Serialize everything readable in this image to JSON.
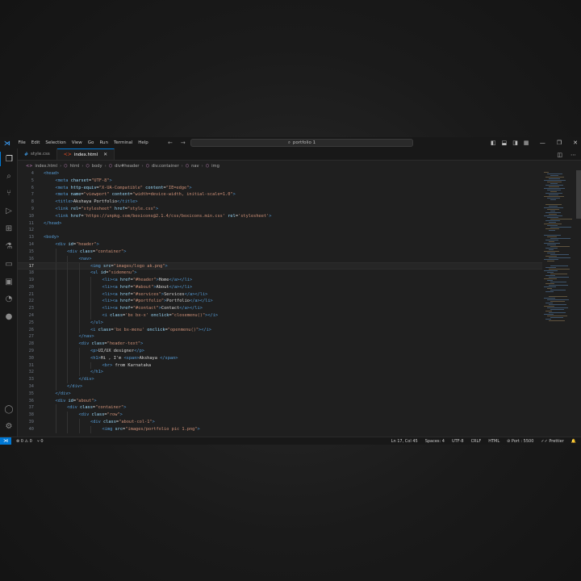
{
  "titlebar": {
    "menu": [
      "File",
      "Edit",
      "Selection",
      "View",
      "Go",
      "Run",
      "Terminal",
      "Help"
    ],
    "search_text": "portfolio 1",
    "win_minimize": "—",
    "win_restore": "❐",
    "win_close": "✕"
  },
  "tabs": [
    {
      "label": "style.css",
      "icon": "css-file-icon",
      "active": false
    },
    {
      "label": "index.html",
      "icon": "html-file-icon",
      "active": true
    }
  ],
  "breadcrumb": [
    "index.html",
    "html",
    "body",
    "div#header",
    "div.container",
    "nav",
    "img"
  ],
  "editor": {
    "lines": [
      {
        "n": "4",
        "indent": 0,
        "html": "<span class=\"tag\">&lt;head&gt;</span>"
      },
      {
        "n": "5",
        "indent": 1,
        "html": "<span class=\"tag\">&lt;meta</span> <span class=\"attr\">charset</span>=<span class=\"val\">\"UTF-8\"</span><span class=\"tag\">&gt;</span>"
      },
      {
        "n": "6",
        "indent": 1,
        "html": "<span class=\"tag\">&lt;meta</span> <span class=\"attr\">http-equiv</span>=<span class=\"val\">\"X-UA-Compatible\"</span> <span class=\"attr\">content</span>=<span class=\"val\">\"IE=edge\"</span><span class=\"tag\">&gt;</span>"
      },
      {
        "n": "7",
        "indent": 1,
        "html": "<span class=\"tag\">&lt;meta</span> <span class=\"attr\">name</span>=<span class=\"val\">\"viewport\"</span> <span class=\"attr\">content</span>=<span class=\"val\">\"width=device-width, initial-scale=1.0\"</span><span class=\"tag\">&gt;</span>"
      },
      {
        "n": "8",
        "indent": 1,
        "html": "<span class=\"tag\">&lt;title&gt;</span><span class=\"txt\">Akshaya Portfolio</span><span class=\"tag\">&lt;/title&gt;</span>"
      },
      {
        "n": "9",
        "indent": 1,
        "html": "<span class=\"tag\">&lt;link</span> <span class=\"attr\">rel</span>=<span class=\"val\">\"stylesheet\"</span> <span class=\"attr\">href</span>=<span class=\"val\">\"style.css\"</span><span class=\"tag\">&gt;</span>"
      },
      {
        "n": "10",
        "indent": 1,
        "html": "<span class=\"tag\">&lt;link</span> <span class=\"attr\">href</span>=<span class=\"val\">'https://unpkg.com/boxicons@2.1.4/css/boxicons.min.css'</span> <span class=\"attr\">rel</span>=<span class=\"val\">'stylesheet'</span><span class=\"tag\">&gt;</span>"
      },
      {
        "n": "11",
        "indent": 0,
        "html": "<span class=\"tag\">&lt;/head&gt;</span>"
      },
      {
        "n": "12",
        "indent": 0,
        "html": ""
      },
      {
        "n": "13",
        "indent": 0,
        "html": "<span class=\"tag\">&lt;body&gt;</span>"
      },
      {
        "n": "14",
        "indent": 1,
        "html": "<span class=\"tag\">&lt;div</span> <span class=\"attr\">id</span>=<span class=\"val\">\"header\"</span><span class=\"tag\">&gt;</span>"
      },
      {
        "n": "15",
        "indent": 2,
        "html": "<span class=\"tag\">&lt;div</span> <span class=\"attr\">class</span>=<span class=\"val\">\"container\"</span><span class=\"tag\">&gt;</span>"
      },
      {
        "n": "16",
        "indent": 3,
        "html": "<span class=\"tag\">&lt;nav&gt;</span>"
      },
      {
        "n": "17",
        "indent": 4,
        "html": "<span class=\"tag\">&lt;img</span> <span class=\"attr\">src</span>=<span class=\"val\">\"images/logo ak.png\"</span><span class=\"tag\">&gt;</span>",
        "current": true
      },
      {
        "n": "18",
        "indent": 4,
        "html": "<span class=\"tag\">&lt;ul</span> <span class=\"attr\">id</span>=<span class=\"val\">\"sidemenu\"</span><span class=\"tag\">&gt;</span>"
      },
      {
        "n": "19",
        "indent": 5,
        "html": "<span class=\"tag\">&lt;li&gt;&lt;a</span> <span class=\"attr\">href</span>=<span class=\"val\">\"#header\"</span><span class=\"tag\">&gt;</span><span class=\"txt\">Home</span><span class=\"tag\">&lt;/a&gt;&lt;/li&gt;</span>"
      },
      {
        "n": "20",
        "indent": 5,
        "html": "<span class=\"tag\">&lt;li&gt;&lt;a</span> <span class=\"attr\">href</span>=<span class=\"val\">\"#about\"</span><span class=\"tag\">&gt;</span><span class=\"txt\">About</span><span class=\"tag\">&lt;/a&gt;&lt;/li&gt;</span>"
      },
      {
        "n": "21",
        "indent": 5,
        "html": "<span class=\"tag\">&lt;li&gt;&lt;a</span> <span class=\"attr\">href</span>=<span class=\"val\">\"#services\"</span><span class=\"tag\">&gt;</span><span class=\"txt\">Services</span><span class=\"tag\">&lt;/a&gt;&lt;/li&gt;</span>"
      },
      {
        "n": "22",
        "indent": 5,
        "html": "<span class=\"tag\">&lt;li&gt;&lt;a</span> <span class=\"attr\">href</span>=<span class=\"val\">\"#portfolio\"</span><span class=\"tag\">&gt;</span><span class=\"txt\">Portfolio</span><span class=\"tag\">&lt;/a&gt;&lt;/li&gt;</span>"
      },
      {
        "n": "23",
        "indent": 5,
        "html": "<span class=\"tag\">&lt;li&gt;&lt;a</span> <span class=\"attr\">href</span>=<span class=\"val\">\"#contact\"</span><span class=\"tag\">&gt;</span><span class=\"txt\">Contact</span><span class=\"tag\">&lt;/a&gt;&lt;/li&gt;</span>"
      },
      {
        "n": "24",
        "indent": 5,
        "html": "<span class=\"tag\">&lt;i</span> <span class=\"attr\">class</span>=<span class=\"val\">'bx bx-x'</span> <span class=\"attr\">onclick</span>=<span class=\"val\">\"closemenu()\"</span><span class=\"tag\">&gt;&lt;/i&gt;</span>"
      },
      {
        "n": "25",
        "indent": 4,
        "html": "<span class=\"tag\">&lt;/ul&gt;</span>"
      },
      {
        "n": "26",
        "indent": 4,
        "html": "<span class=\"tag\">&lt;i</span> <span class=\"attr\">class</span>=<span class=\"val\">'bx bx-menu'</span> <span class=\"attr\">onclick</span>=<span class=\"val\">\"openmenu()\"</span><span class=\"tag\">&gt;&lt;/i&gt;</span>"
      },
      {
        "n": "27",
        "indent": 3,
        "html": "<span class=\"tag\">&lt;/nav&gt;</span>"
      },
      {
        "n": "28",
        "indent": 3,
        "html": "<span class=\"tag\">&lt;div</span> <span class=\"attr\">class</span>=<span class=\"val\">\"header-text\"</span><span class=\"tag\">&gt;</span>"
      },
      {
        "n": "29",
        "indent": 4,
        "html": "<span class=\"tag\">&lt;p&gt;</span><span class=\"txt\">UI/UX designer</span><span class=\"tag\">&lt;/p&gt;</span>"
      },
      {
        "n": "30",
        "indent": 4,
        "html": "<span class=\"tag\">&lt;h1&gt;</span><span class=\"txt\">Hi , I'm </span><span class=\"tag\">&lt;span&gt;</span><span class=\"txt\">Akshaya </span><span class=\"tag\">&lt;/span&gt;</span>"
      },
      {
        "n": "31",
        "indent": 5,
        "html": "<span class=\"tag\">&lt;br&gt;</span><span class=\"txt\"> from Karnataka</span>"
      },
      {
        "n": "32",
        "indent": 4,
        "html": "<span class=\"tag\">&lt;/h1&gt;</span>"
      },
      {
        "n": "33",
        "indent": 3,
        "html": "<span class=\"tag\">&lt;/div&gt;</span>"
      },
      {
        "n": "34",
        "indent": 2,
        "html": "<span class=\"tag\">&lt;/div&gt;</span>"
      },
      {
        "n": "35",
        "indent": 1,
        "html": "<span class=\"tag\">&lt;/div&gt;</span>"
      },
      {
        "n": "36",
        "indent": 1,
        "html": "<span class=\"tag\">&lt;div</span> <span class=\"attr\">id</span>=<span class=\"val\">\"about\"</span><span class=\"tag\">&gt;</span>"
      },
      {
        "n": "37",
        "indent": 2,
        "html": "<span class=\"tag\">&lt;div</span> <span class=\"attr\">class</span>=<span class=\"val\">\"container\"</span><span class=\"tag\">&gt;</span>"
      },
      {
        "n": "38",
        "indent": 3,
        "html": "<span class=\"tag\">&lt;div</span> <span class=\"attr\">class</span>=<span class=\"val\">\"row\"</span><span class=\"tag\">&gt;</span>"
      },
      {
        "n": "39",
        "indent": 4,
        "html": "<span class=\"tag\">&lt;div</span> <span class=\"attr\">class</span>=<span class=\"val\">\"about-col-1\"</span><span class=\"tag\">&gt;</span>"
      },
      {
        "n": "40",
        "indent": 5,
        "html": "<span class=\"tag\">&lt;img</span> <span class=\"attr\">src</span>=<span class=\"val\">\"images/portfolio pic 1.png\"</span><span class=\"tag\">&gt;</span>"
      }
    ]
  },
  "statusbar": {
    "problems": "⊗ 0 ⚠ 0",
    "ports": "⑂ 0",
    "position": "Ln 17, Col 45",
    "spaces": "Spaces: 4",
    "encoding": "UTF-8",
    "eol": "CRLF",
    "language": "HTML",
    "port": "⊘ Port : 5500",
    "prettier": "✓✓ Prettier",
    "bell": "🔔"
  }
}
